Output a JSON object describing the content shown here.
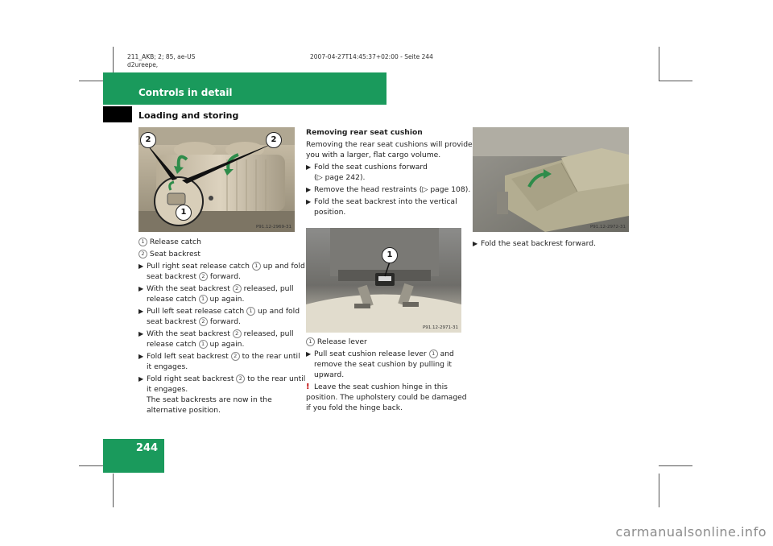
{
  "meta": {
    "line1_left": "211_AKB; 2; 85, ae-US",
    "line1_right": "2007-04-27T14:45:37+02:00 - Seite 244",
    "line2": "d2ureepe,"
  },
  "header": {
    "section": "Controls in detail",
    "subsection": "Loading and storing"
  },
  "page_number": "244",
  "photos": {
    "p1": {
      "code": "P91.12-2969-31",
      "c1": "1",
      "c2": "2"
    },
    "p2": {
      "code": "P91.12-2971-31",
      "c1": "1"
    },
    "p3": {
      "code": "P91.12-2972-31"
    }
  },
  "col1": {
    "legend1_num": "1",
    "legend1": "Release catch",
    "legend2_num": "2",
    "legend2": "Seat backrest",
    "s1a": "Pull right seat release catch",
    "s1a_n": "1",
    "s1a_b": "up and fold",
    "s1b": "seat backrest",
    "s1b_n": "2",
    "s1b_b": "forward.",
    "s2a": "With the seat backrest",
    "s2a_n": "2",
    "s2a_b": "released, pull",
    "s2b": "release catch",
    "s2b_n": "1",
    "s2b_b": "up again.",
    "s3a": "Pull left seat release catch",
    "s3a_n": "1",
    "s3a_b": "up and fold",
    "s3b": "seat backrest",
    "s3b_n": "2",
    "s3b_b": "forward.",
    "s4a": "With the seat backrest",
    "s4a_n": "2",
    "s4a_b": "released, pull",
    "s4b": "release catch",
    "s4b_n": "1",
    "s4b_b": "up again.",
    "s5a": "Fold left seat backrest",
    "s5a_n": "2",
    "s5a_b": "to the rear until",
    "s5b": "it engages.",
    "s6a": "Fold right seat backrest",
    "s6a_n": "2",
    "s6a_b": "to the rear until",
    "s6b": "it engages.",
    "note1": "The seat backrests are now in the",
    "note2": "alternative position."
  },
  "col2": {
    "heading": "Removing rear seat cushion",
    "intro1": "Removing the rear seat cushions will provide",
    "intro2": "you with a larger, flat cargo volume.",
    "s1a": "Fold the seat cushions forward",
    "s1b": "(▷ page 242).",
    "s2": "Remove the head restraints (▷ page 108).",
    "s3a": "Fold the seat backrest into the vertical",
    "s3b": "position.",
    "legend1_num": "1",
    "legend1": "Release lever",
    "s4a": "Pull seat cushion release lever",
    "s4a_n": "1",
    "s4a_b": "and",
    "s4b": "remove the seat cushion by pulling it",
    "s4c": "upward.",
    "warn_mark": "!",
    "warn1": "Leave the seat cushion hinge in this",
    "warn2": "position. The upholstery could be damaged",
    "warn3": "if you fold the hinge back."
  },
  "col3": {
    "s1": "Fold the seat backrest forward."
  },
  "watermark": "carmanualsonline.info"
}
